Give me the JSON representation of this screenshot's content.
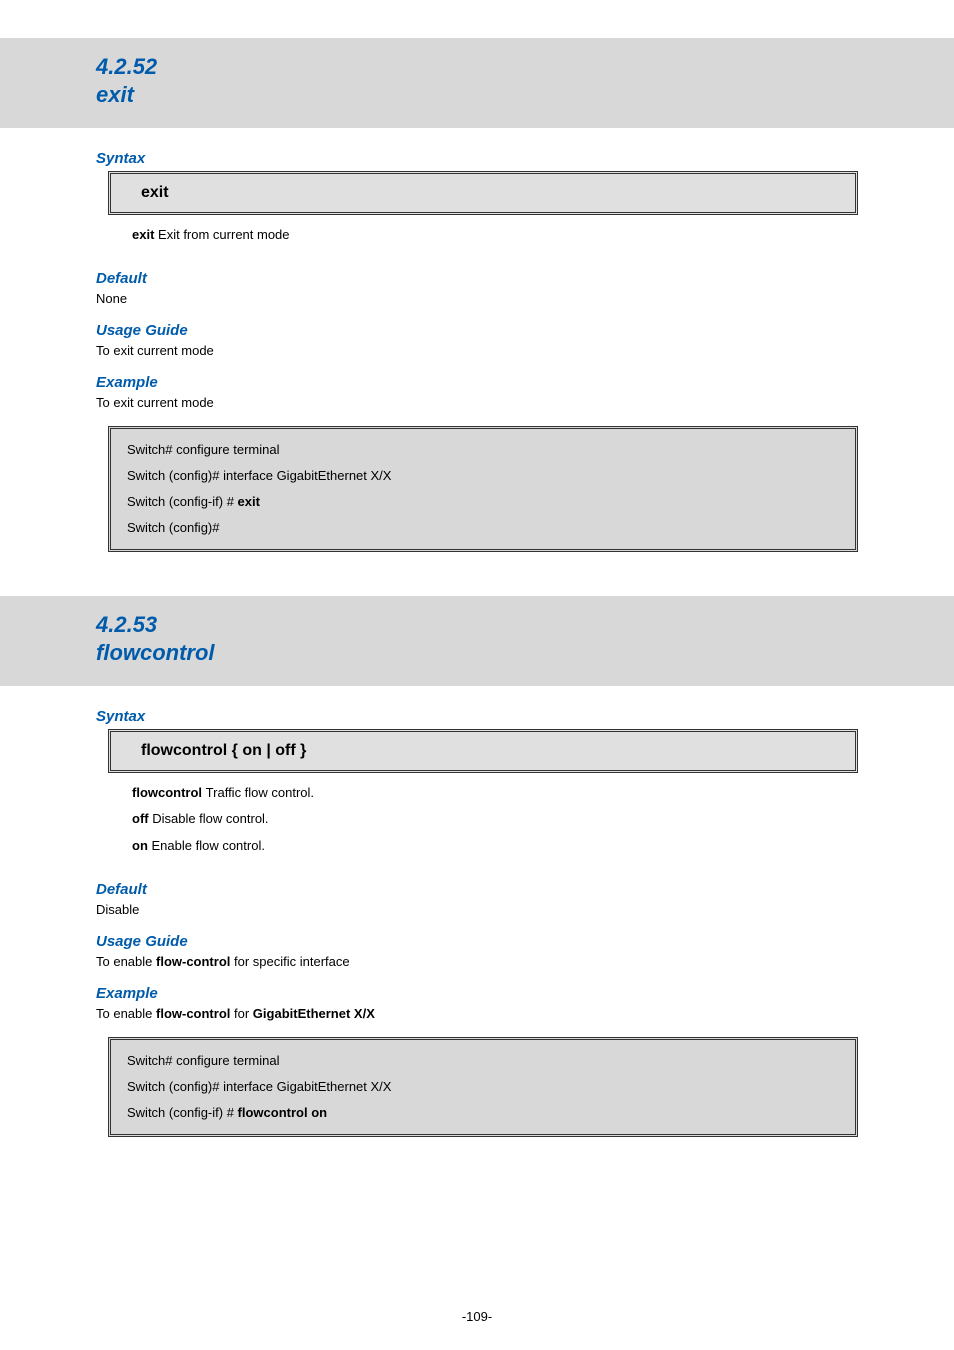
{
  "sec1": {
    "num": "4.2.52",
    "title": "exit",
    "syntaxHdr": "Syntax",
    "syntaxBox": "exit",
    "param1_k": "exit",
    "param1_v": "Exit from current mode",
    "defaultHdr": "Default",
    "defaultTxt": "None",
    "usageHdr": "Usage Guide",
    "usageTxt": "To exit current mode",
    "exampleHdr": "Example",
    "exampleTxt": "To exit current mode",
    "code1": "Switch# configure terminal",
    "code2": "Switch (config)# interface GigabitEthernet X/X",
    "code3a": "Switch (config-if) # ",
    "code3b": "exit",
    "code4": "Switch (config)#"
  },
  "sec2": {
    "num": "4.2.53",
    "title": "flowcontrol",
    "syntaxHdr": "Syntax",
    "syntaxBox": "flowcontrol { on | off }",
    "p1_k": "flowcontrol     ",
    "p1_v": "Traffic flow control.",
    "p2_k": "off  ",
    "p2_v": "Disable flow control.",
    "p3_k": "on  ",
    "p3_v": "Enable flow control.",
    "defaultHdr": "Default",
    "defaultTxt": "Disable",
    "usageHdr": "Usage Guide",
    "usagePre": "To enable ",
    "usageBold": "flow-control",
    "usagePost": " for specific interface",
    "exampleHdr": "Example",
    "exPre": "To enable ",
    "exBold": "flow-control",
    "exMid": " for ",
    "exBold2": "GigabitEthernet X/X",
    "code1": "Switch# configure terminal",
    "code2": "Switch (config)# interface GigabitEthernet X/X",
    "code3a": "Switch (config-if) # ",
    "code3b": "flowcontrol on"
  },
  "footer": "-109-"
}
